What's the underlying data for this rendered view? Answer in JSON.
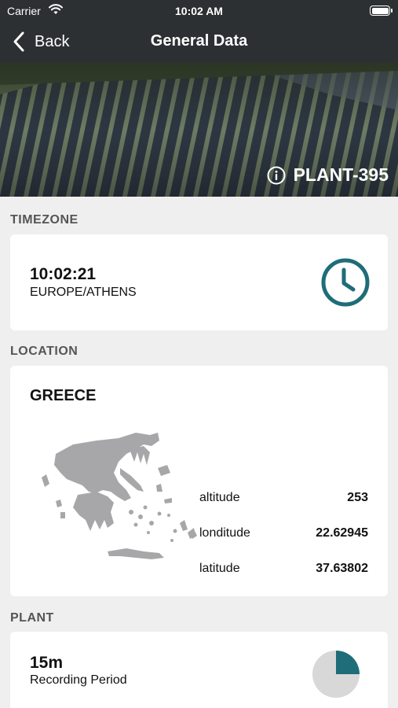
{
  "status_bar": {
    "carrier": "Carrier",
    "time": "10:02 AM"
  },
  "nav": {
    "back_label": "Back",
    "title": "General Data"
  },
  "hero": {
    "plant_id": "PLANT-395"
  },
  "timezone": {
    "section_label": "TIMEZONE",
    "time": "10:02:21",
    "zone": "EUROPE/ATHENS"
  },
  "location": {
    "section_label": "LOCATION",
    "country": "GREECE",
    "rows": [
      {
        "key": "altitude",
        "value": "253"
      },
      {
        "key": "londitude",
        "value": "22.62945"
      },
      {
        "key": "latitude",
        "value": "37.63802"
      }
    ]
  },
  "plant": {
    "section_label": "PLANT",
    "recording_value": "15m",
    "recording_label": "Recording Period",
    "recording_fraction": 0.25
  },
  "colors": {
    "accent": "#1e6d78",
    "header": "#2d3032",
    "map": "#a7a7a9",
    "pie_rest": "#d8d8d8"
  }
}
